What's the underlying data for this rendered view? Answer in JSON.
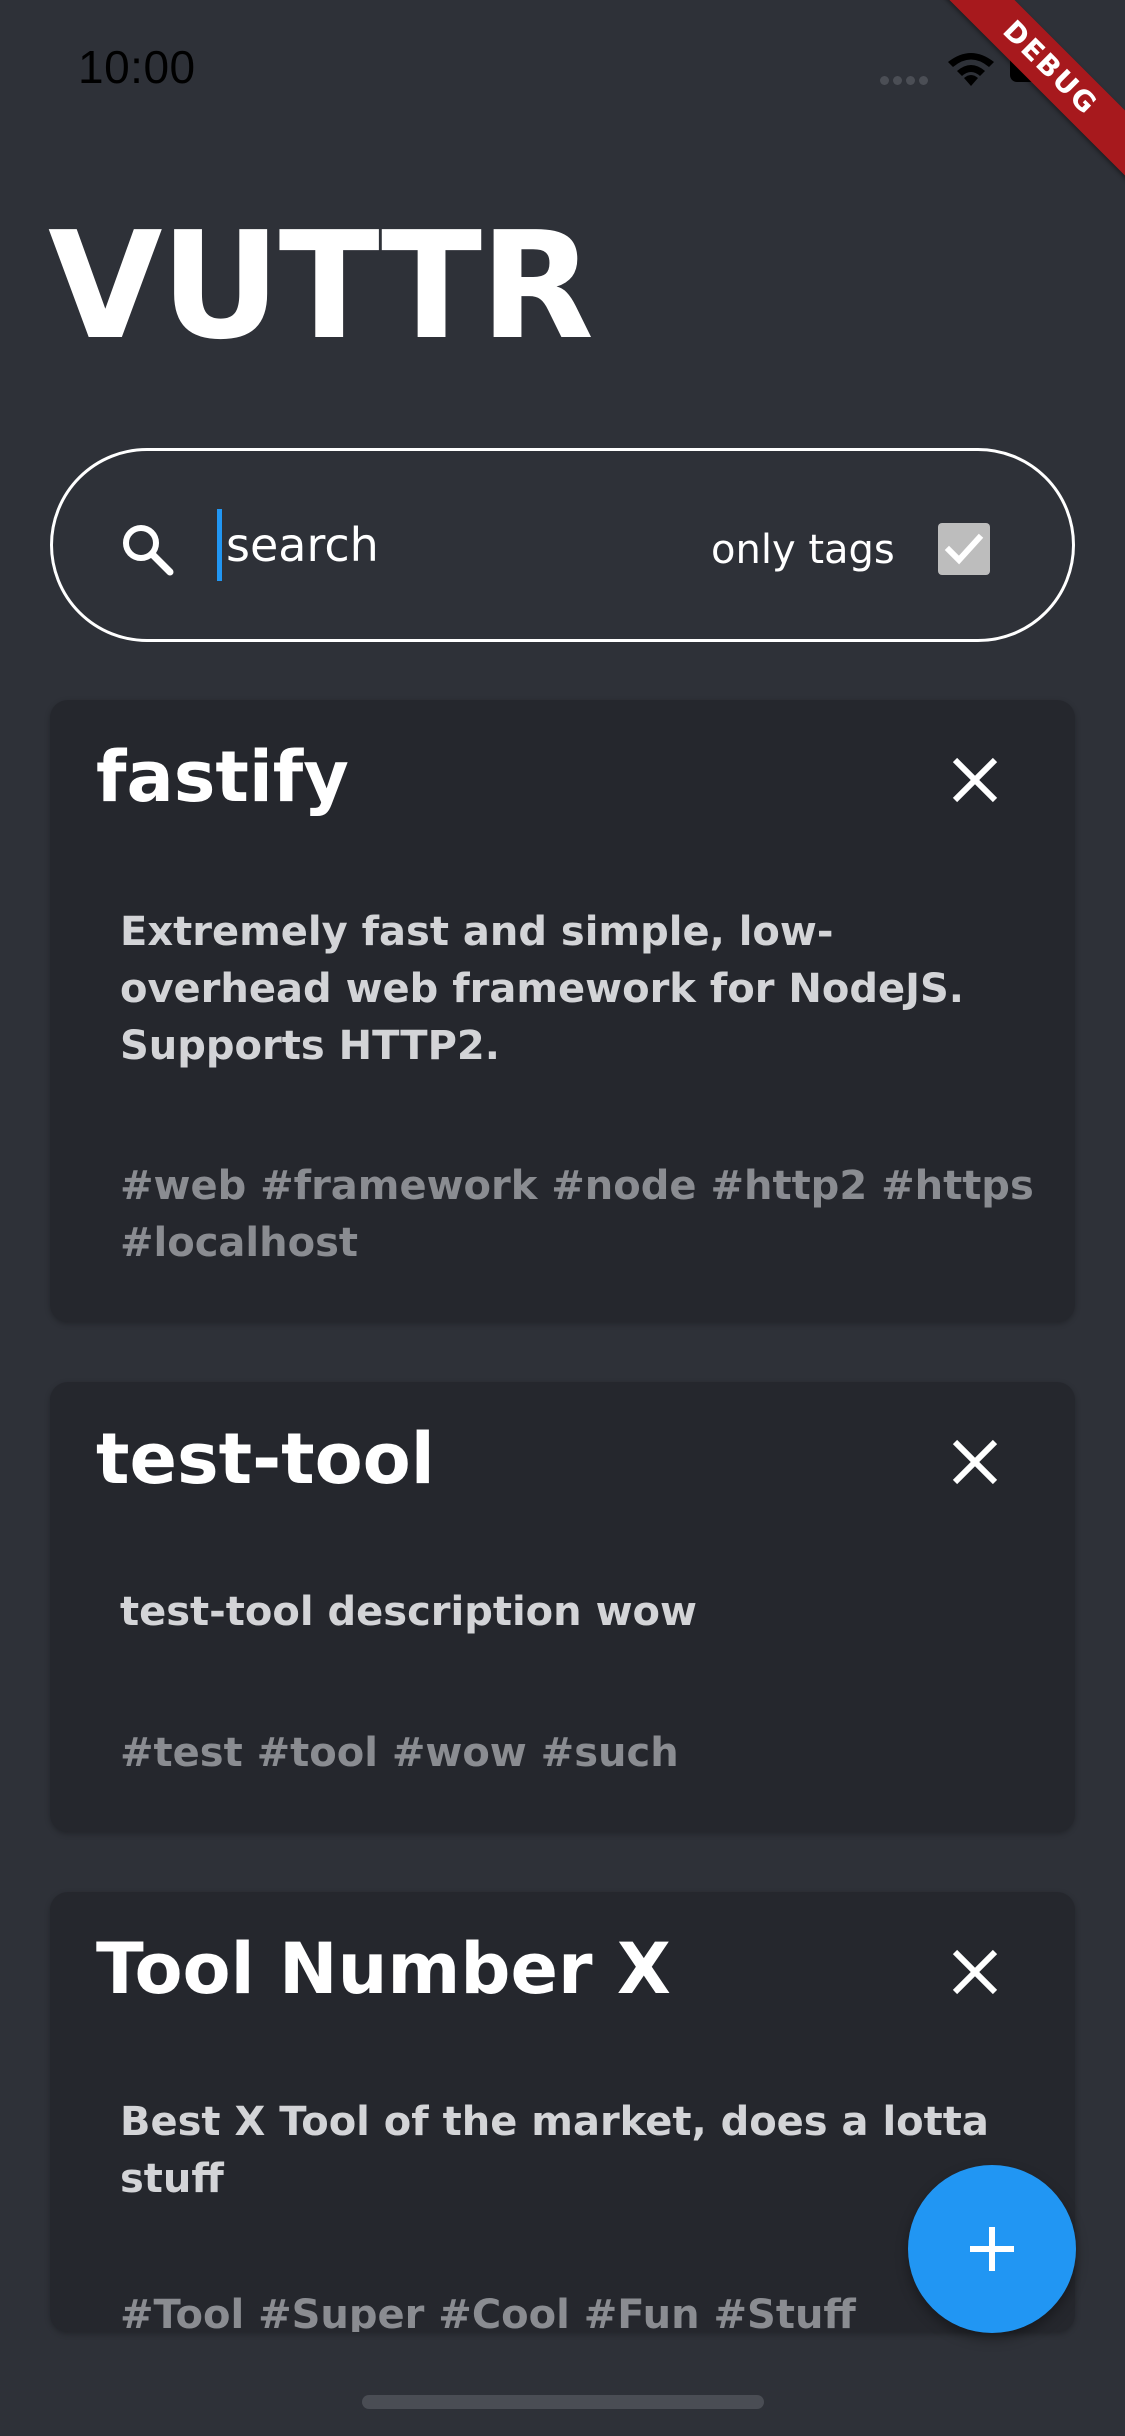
{
  "status_bar": {
    "time": "10:00",
    "debug_label": "DEBUG"
  },
  "app": {
    "title": "VUTTR"
  },
  "search": {
    "placeholder": "search",
    "value": "",
    "only_tags_label": "only tags",
    "only_tags_checked": true
  },
  "tools": [
    {
      "title": "fastify",
      "description": "Extremely fast and simple, low-overhead web framework for NodeJS. Supports HTTP2.",
      "tags": "#web #framework #node #http2 #https #localhost"
    },
    {
      "title": "test-tool",
      "description": "test-tool description wow",
      "tags": "#test #tool #wow #such"
    },
    {
      "title": "Tool Number X",
      "description": "Best X Tool of the market, does a lotta stuff",
      "tags": "#Tool #Super #Cool #Fun #Stuff"
    }
  ],
  "icons": {
    "search": "search-icon",
    "delete": "close-icon",
    "add": "plus-icon",
    "checkbox": "check-icon"
  },
  "colors": {
    "background": "#2e3138",
    "card": "#25272d",
    "accent": "#2196f3",
    "tag_text": "#8a8c91",
    "debug_ribbon": "#a7191d"
  }
}
